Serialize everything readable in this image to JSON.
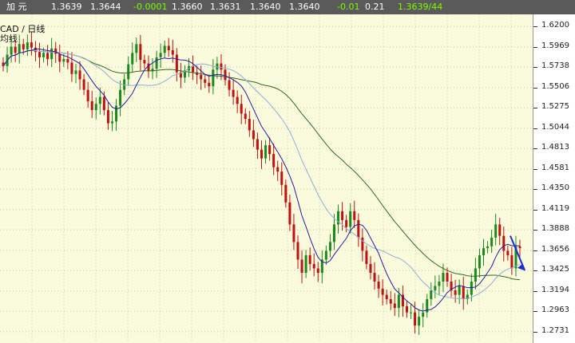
{
  "quote_bar": {
    "name": "加 元",
    "open": "1.3639",
    "high": "1.3644",
    "change": "-0.0001",
    "v1": "1.3660",
    "v2": "1.3631",
    "v3": "1.3640",
    "v4": "1.3640",
    "change_pct": "-0.01",
    "v5": "0.21",
    "bid_ask": "1.3639/44"
  },
  "chart_header": {
    "title": "CAD / 日线",
    "subtitle": "均线"
  },
  "colors": {
    "bull_candle": "#1a8a1a",
    "bear_candle": "#c01010",
    "ma_short": "#2a1aa0",
    "ma_mid": "#8fb0d8",
    "ma_long": "#2e6b1e",
    "arrow": "#1a2ed8"
  },
  "chart_data": {
    "type": "candlestick",
    "title": "CAD / 日线",
    "y_axis_ticks": [
      "1.6200",
      "1.5969",
      "1.5738",
      "1.5506",
      "1.5275",
      "1.5044",
      "1.4813",
      "1.4581",
      "1.4350",
      "1.4119",
      "1.3888",
      "1.3656",
      "1.3425",
      "1.3194",
      "1.2963",
      "1.2731"
    ],
    "ylim": [
      1.262,
      1.632
    ],
    "grid": true,
    "close_series": [
      1.575,
      1.588,
      1.597,
      1.59,
      1.6,
      1.594,
      1.602,
      1.596,
      1.591,
      1.585,
      1.59,
      1.583,
      1.595,
      1.589,
      1.58,
      1.583,
      1.579,
      1.566,
      1.57,
      1.56,
      1.548,
      1.535,
      1.525,
      1.532,
      1.54,
      1.525,
      1.51,
      1.512,
      1.53,
      1.548,
      1.56,
      1.577,
      1.59,
      1.6,
      1.582,
      1.578,
      1.569,
      1.572,
      1.585,
      1.59,
      1.598,
      1.593,
      1.588,
      1.568,
      1.562,
      1.57,
      1.575,
      1.568,
      1.565,
      1.56,
      1.556,
      1.552,
      1.571,
      1.578,
      1.571,
      1.559,
      1.548,
      1.54,
      1.532,
      1.521,
      1.515,
      1.502,
      1.492,
      1.48,
      1.47,
      1.485,
      1.475,
      1.46,
      1.455,
      1.44,
      1.42,
      1.395,
      1.375,
      1.355,
      1.34,
      1.36,
      1.35,
      1.345,
      1.34,
      1.355,
      1.365,
      1.375,
      1.395,
      1.41,
      1.4,
      1.392,
      1.41,
      1.4,
      1.38,
      1.365,
      1.35,
      1.34,
      1.33,
      1.322,
      1.315,
      1.31,
      1.305,
      1.3,
      1.315,
      1.302,
      1.295,
      1.295,
      1.28,
      1.29,
      1.295,
      1.31,
      1.32,
      1.325,
      1.33,
      1.34,
      1.33,
      1.32,
      1.315,
      1.325,
      1.31,
      1.315,
      1.33,
      1.345,
      1.36,
      1.368,
      1.37,
      1.38,
      1.395,
      1.382,
      1.365,
      1.36,
      1.345,
      1.37,
      1.368
    ],
    "y_axis_side": "right"
  }
}
